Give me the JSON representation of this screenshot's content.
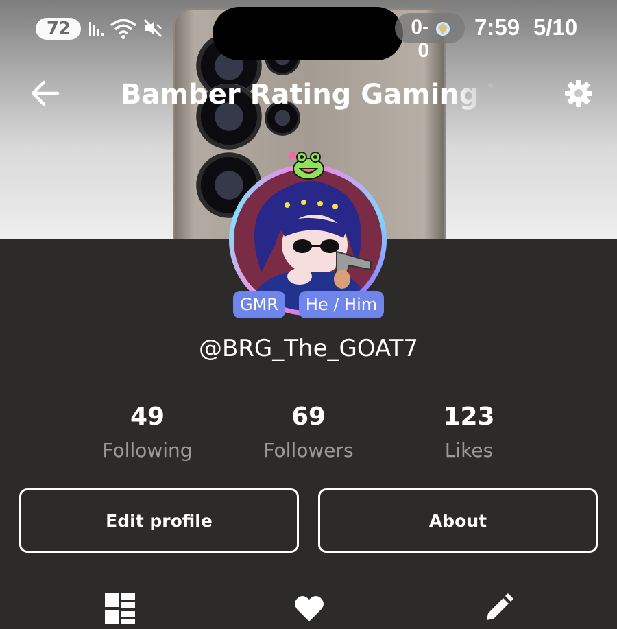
{
  "status_bar": {
    "battery": "72",
    "score": "0-0",
    "time": "7:59",
    "date": "5/10",
    "icons": [
      "signal-icon",
      "wifi-icon",
      "mute-icon",
      "team-crest-icon"
    ]
  },
  "header": {
    "title": "Bamber Rating Gaming The GOAT",
    "back_icon": "arrow-left-icon",
    "settings_icon": "gear-icon"
  },
  "profile": {
    "username": "@BRG_The_GOAT7",
    "tags": [
      "GMR",
      "He / Him"
    ],
    "stats": [
      {
        "value": "49",
        "label": "Following"
      },
      {
        "value": "69",
        "label": "Followers"
      },
      {
        "value": "123",
        "label": "Likes"
      }
    ]
  },
  "actions": {
    "edit_label": "Edit profile",
    "about_label": "About"
  },
  "tabs": {
    "icons": [
      "grid-icon",
      "heart-icon",
      "pencil-icon"
    ]
  },
  "colors": {
    "background": "#2c2b29",
    "tag_fill": "#6f85ea",
    "secondary_text": "#9a9a96"
  }
}
